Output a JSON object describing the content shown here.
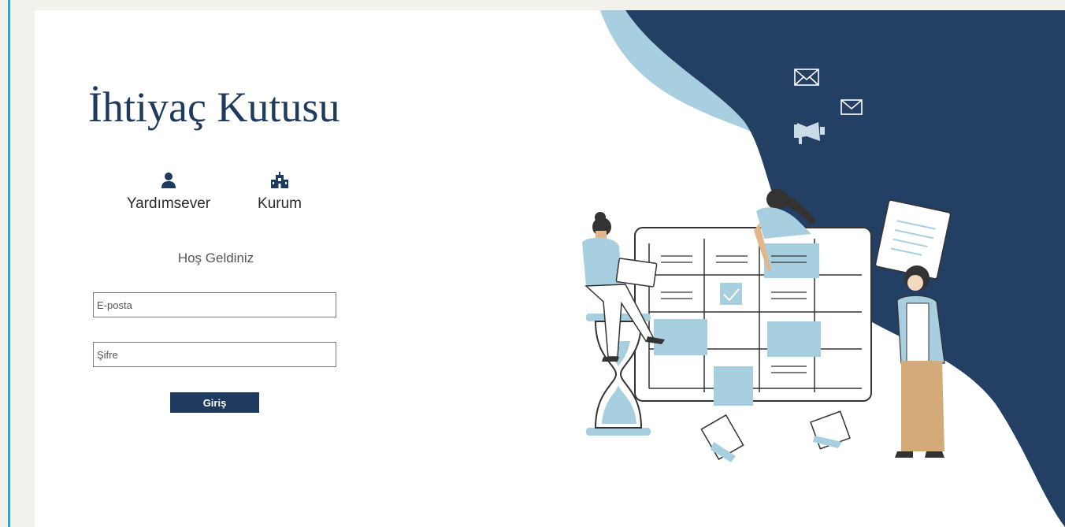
{
  "app": {
    "title": "İhtiyaç Kutusu"
  },
  "roles": [
    {
      "label": "Yardımsever",
      "icon": "user-icon"
    },
    {
      "label": "Kurum",
      "icon": "building-icon"
    }
  ],
  "login": {
    "welcome": "Hoş Geldiniz",
    "email_placeholder": "E-posta",
    "password_placeholder": "Şifre",
    "submit_label": "Giriş"
  },
  "colors": {
    "brand": "#1f3a5f",
    "accent_light": "#a8cfe0",
    "frame": "#2aa7d8",
    "background": "#f3f1ec"
  }
}
